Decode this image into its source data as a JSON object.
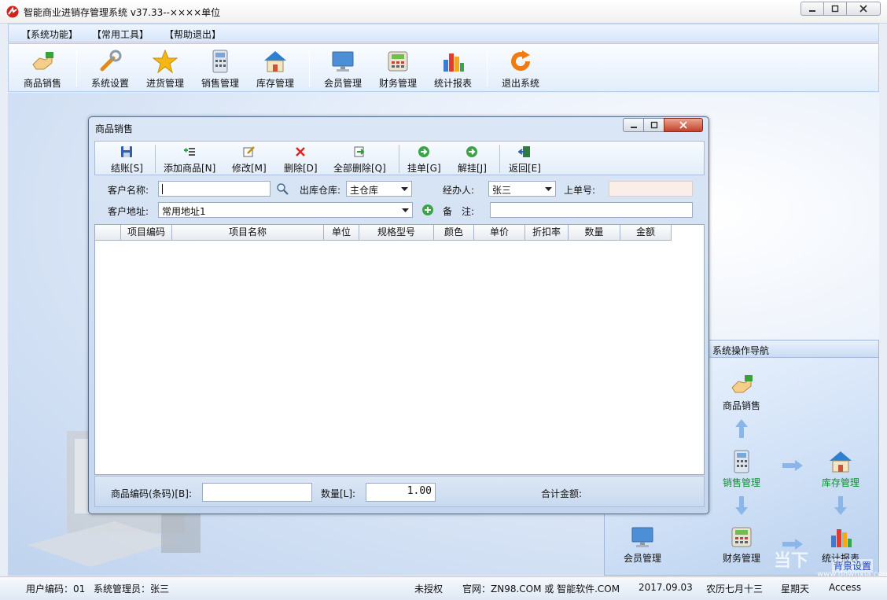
{
  "app": {
    "title": "智能商业进销存管理系统 v37.33--××××单位",
    "menu": [
      "【系统功能】",
      "【常用工具】",
      "【帮助退出】"
    ]
  },
  "toolbar": {
    "items": [
      "商品销售",
      "系统设置",
      "进货管理",
      "销售管理",
      "库存管理",
      "会员管理",
      "财务管理",
      "统计报表",
      "退出系统"
    ]
  },
  "dialog": {
    "title": "商品销售",
    "toolbar": [
      "结账[S]",
      "添加商品[N]",
      "修改[M]",
      "删除[D]",
      "全部删除[Q]",
      "挂单[G]",
      "解挂[J]",
      "返回[E]"
    ],
    "form": {
      "customer_name_label": "客户名称:",
      "customer_name_value": "",
      "warehouse_label": "出库仓库:",
      "warehouse_value": "主仓库",
      "handler_label": "经办人:",
      "handler_value": "张三",
      "prev_order_label": "上单号:",
      "prev_order_value": "",
      "address_label": "客户地址:",
      "address_value": "常用地址1",
      "remark_label": "备　注:",
      "remark_value": ""
    },
    "grid_columns": [
      "",
      "项目编码",
      "项目名称",
      "单位",
      "规格型号",
      "颜色",
      "单价",
      "折扣率",
      "数量",
      "金额"
    ],
    "footer": {
      "barcode_label": "商品编码(条码)[B]:",
      "barcode_value": "",
      "qty_label": "数量[L]:",
      "qty_value": "1.00",
      "total_label": "合计金额:"
    }
  },
  "nav": {
    "title": "系统操作导航",
    "items": [
      "商品销售",
      "销售管理",
      "库存管理",
      "会员管理",
      "财务管理",
      "统计报表"
    ],
    "watermark": "当下",
    "watermark_url": "www.downxia.com",
    "bg_settings": "背景设置"
  },
  "status": {
    "user_code": "用户编码：01",
    "user": "系统管理员：张三",
    "license": "未授权",
    "site": "官网：ZN98.COM 或 智能软件.COM",
    "date": "2017.09.03",
    "lunar": "农历七月十三",
    "weekday": "星期天",
    "db": "Access"
  },
  "colors": {
    "accent": "#3d7ac7",
    "nav_green": "#0b8f2e",
    "link_blue": "#1a3fb8"
  }
}
